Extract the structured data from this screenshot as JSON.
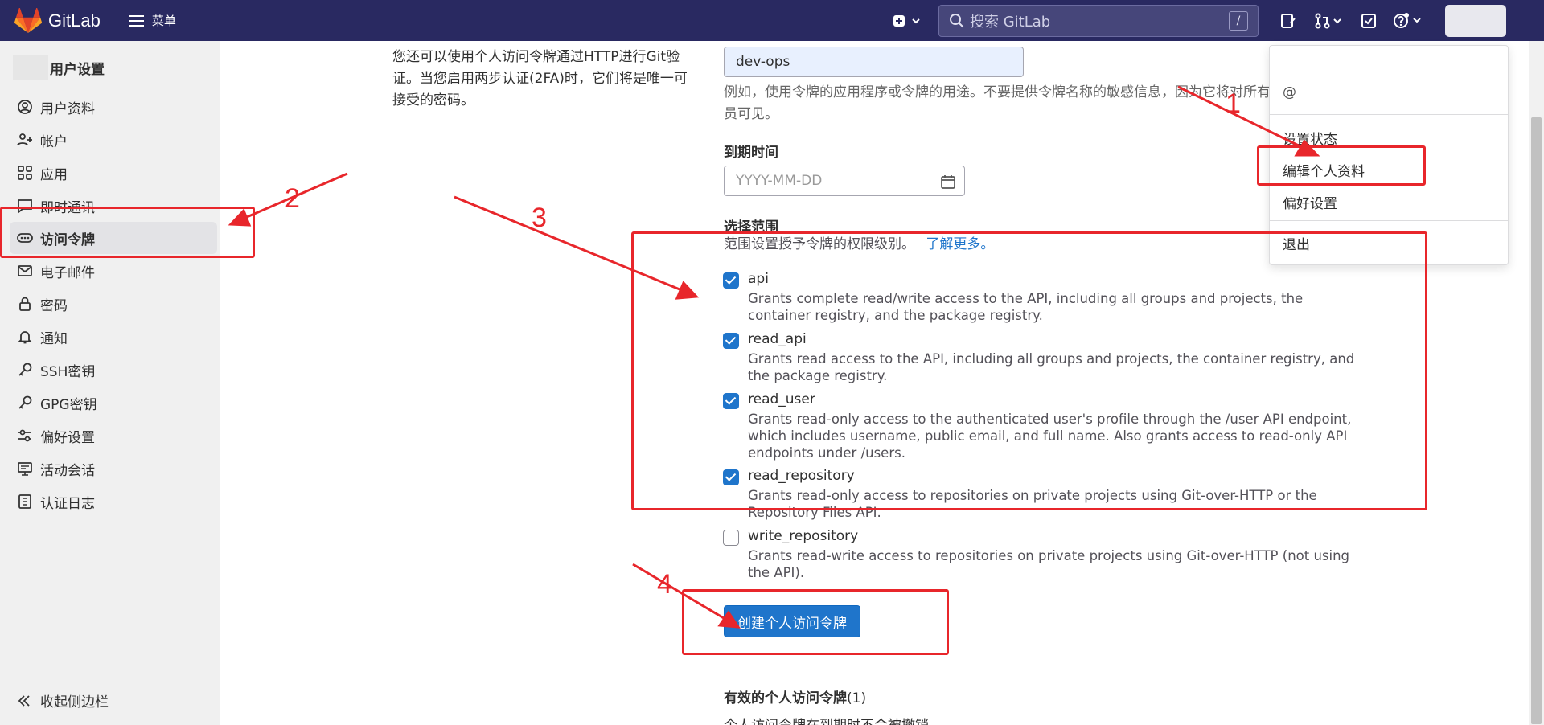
{
  "header": {
    "logo_text": "GitLab",
    "menu_label": "菜单",
    "search_placeholder": "搜索 GitLab",
    "search_shortcut": "/"
  },
  "sidebar": {
    "title": "用户设置",
    "items": [
      {
        "label": "用户资料",
        "icon": "profile-icon"
      },
      {
        "label": "帐户",
        "icon": "account-icon"
      },
      {
        "label": "应用",
        "icon": "applications-icon"
      },
      {
        "label": "即时通讯",
        "icon": "chat-icon"
      },
      {
        "label": "访问令牌",
        "icon": "token-icon",
        "active": true
      },
      {
        "label": "电子邮件",
        "icon": "mail-icon"
      },
      {
        "label": "密码",
        "icon": "lock-icon"
      },
      {
        "label": "通知",
        "icon": "bell-icon"
      },
      {
        "label": "SSH密钥",
        "icon": "key-icon"
      },
      {
        "label": "GPG密钥",
        "icon": "key-icon"
      },
      {
        "label": "偏好设置",
        "icon": "preferences-icon"
      },
      {
        "label": "活动会话",
        "icon": "monitor-icon"
      },
      {
        "label": "认证日志",
        "icon": "log-icon"
      }
    ],
    "collapse_label": "收起侧边栏"
  },
  "main": {
    "intro_text": "您还可以使用个人访问令牌通过HTTP进行Git验证。当您启用两步认证(2FA)时，它们将是唯一可接受的密码。",
    "token_name_value": "dev-ops",
    "token_name_help": "例如，使用令牌的应用程序或令牌的用途。不要提供令牌名称的敏感信息，因为它将对所有",
    "token_name_help_line2": "员可见。",
    "expiry_label": "到期时间",
    "expiry_placeholder": "YYYY-MM-DD",
    "scopes_label": "选择范围",
    "scopes_help": "范围设置授予令牌的权限级别。",
    "scopes_learn_more": "了解更多。",
    "scopes": [
      {
        "name": "api",
        "checked": true,
        "desc": "Grants complete read/write access to the API, including all groups and projects, the container registry, and the package registry."
      },
      {
        "name": "read_api",
        "checked": true,
        "desc": "Grants read access to the API, including all groups and projects, the container registry, and the package registry."
      },
      {
        "name": "read_user",
        "checked": true,
        "desc": "Grants read-only access to the authenticated user's profile through the /user API endpoint, which includes username, public email, and full name. Also grants access to read-only API endpoints under /users."
      },
      {
        "name": "read_repository",
        "checked": true,
        "desc": "Grants read-only access to repositories on private projects using Git-over-HTTP or the Repository Files API."
      },
      {
        "name": "write_repository",
        "checked": false,
        "desc": "Grants read-write access to repositories on private projects using Git-over-HTTP (not using the API)."
      }
    ],
    "create_button": "创建个人访问令牌",
    "active_tokens_title": "有效的个人访问令牌",
    "active_tokens_count": "(1)",
    "active_tokens_sub": "个人访问令牌在到期时不会被撤销"
  },
  "dropdown": {
    "handle": "@",
    "set_status": "设置状态",
    "edit_profile": "编辑个人资料",
    "preferences": "偏好设置",
    "sign_out": "退出"
  },
  "annotations": {
    "numbers": [
      "1",
      "2",
      "3",
      "4"
    ],
    "color": "#e8262b"
  },
  "colors": {
    "topbar": "#292961",
    "primary": "#1f75cb",
    "sidebar_bg": "#f0f0f0"
  }
}
